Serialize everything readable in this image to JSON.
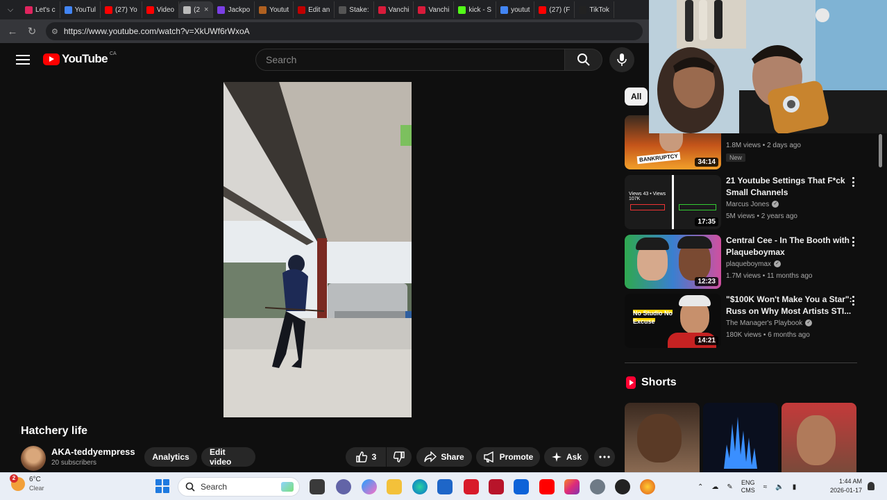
{
  "browser": {
    "tabs": [
      {
        "label": "Let's c",
        "color": "#e0245e"
      },
      {
        "label": "YouTul",
        "color": "#4285f4"
      },
      {
        "label": "(27) Yo",
        "color": "#ff0000"
      },
      {
        "label": "Video",
        "color": "#ff0000"
      },
      {
        "label": "(2",
        "color": "#bbbbbb",
        "active": true
      },
      {
        "label": "Jackpo",
        "color": "#7b3fe4"
      },
      {
        "label": "Youtut",
        "color": "#b06020"
      },
      {
        "label": "Edit an",
        "color": "#c00000"
      },
      {
        "label": "Stake:",
        "color": "#555555"
      },
      {
        "label": "Vanchi",
        "color": "#d81b3a"
      },
      {
        "label": "Vanchi",
        "color": "#d81b3a"
      },
      {
        "label": "kick - S",
        "color": "#53fc18"
      },
      {
        "label": "youtut",
        "color": "#4285f4"
      },
      {
        "label": "(27) (F",
        "color": "#ff0000"
      },
      {
        "label": "TikTok",
        "color": "#222222"
      }
    ],
    "url": "https://www.youtube.com/watch?v=XkUWf6rWxoA"
  },
  "youtube": {
    "logo_text": "YouTube",
    "country_code": "CA",
    "search_placeholder": "Search"
  },
  "video": {
    "title": "Hatchery life",
    "channel": "AKA-teddyempress",
    "subscribers": "20 subscribers",
    "analytics_label": "Analytics",
    "edit_label": "Edit video",
    "like_count": "3",
    "share_label": "Share",
    "promote_label": "Promote",
    "ask_label": "Ask"
  },
  "sidebar": {
    "chip_all": "All",
    "recommendations": [
      {
        "title": "",
        "channel": "",
        "meta": "1.8M views • 2 days ago",
        "badge": "New",
        "duration": "34:14",
        "thumb_text": "BANKRUPTCY"
      },
      {
        "title": "21 Youtube Settings That F*ck Small Channels",
        "channel": "Marcus Jones",
        "meta": "5M views • 2 years ago",
        "duration": "17:35",
        "thumb_text": "Views 43 • Views 107K"
      },
      {
        "title": "Central Cee - In The Booth with Plaqueboymax",
        "channel": "plaqueboymax",
        "meta": "1.7M views • 11 months ago",
        "duration": "12:23"
      },
      {
        "title": "\"$100K Won't Make You a Star\": Russ on Why Most Artists STI...",
        "channel": "The Manager's Playbook",
        "meta": "180K views • 6 months ago",
        "duration": "14:21",
        "thumb_text": "No Studio No Excuse"
      }
    ],
    "shorts_label": "Shorts"
  },
  "taskbar": {
    "weather_temp": "6°C",
    "weather_cond": "Clear",
    "weather_badge": "2",
    "search_label": "Search",
    "lang_top": "ENG",
    "lang_bottom": "CMS",
    "time": "1:44 AM",
    "date": "2026-01-17"
  },
  "colors": {
    "youtube_red": "#ff0000",
    "background": "#0f0f0f",
    "taskbar": "#e9eef6"
  }
}
